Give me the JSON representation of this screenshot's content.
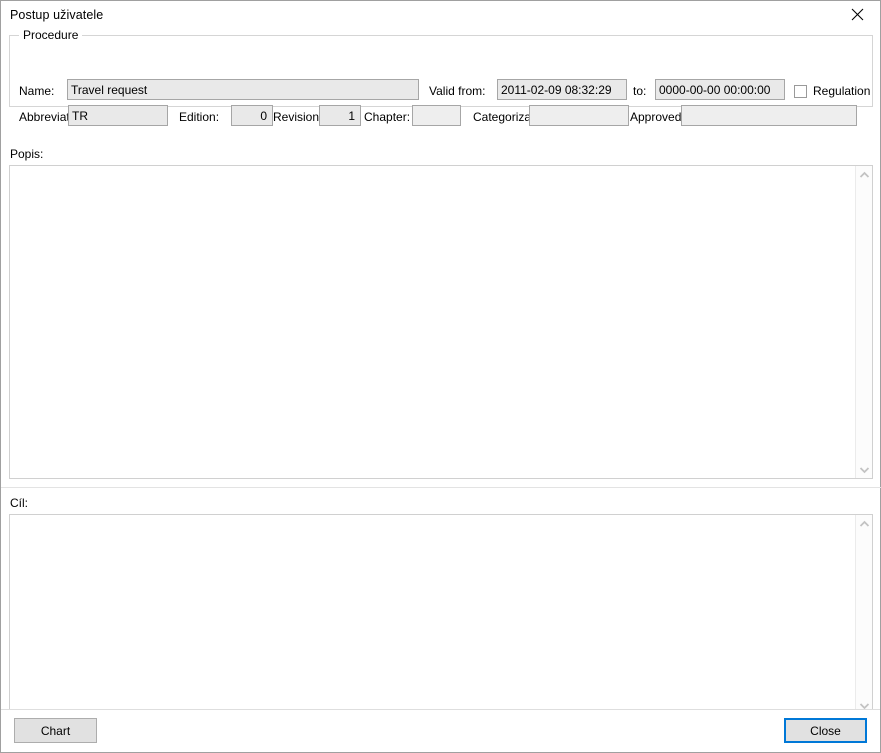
{
  "window": {
    "title": "Postup uživatele",
    "close_icon": "close-icon"
  },
  "procedure_group": {
    "legend": "Procedure",
    "fields": {
      "name_label": "Name:",
      "name_value": "Travel request",
      "valid_from_label": "Valid from:",
      "valid_from_value": "2011-02-09 08:32:29",
      "to_label": "to:",
      "to_value": "0000-00-00 00:00:00",
      "regulation_label": "Regulation",
      "regulation_checked": false,
      "abbreviation_label": "Abbreviation",
      "abbreviation_value": "TR",
      "edition_label": "Edition:",
      "edition_value": "0",
      "revision_label": "Revision",
      "revision_value": "1",
      "chapter_label": "Chapter:",
      "chapter_value": "",
      "categorization_label": "Categorization",
      "categorization_value": "",
      "approved_label": "Approved",
      "approved_value": ""
    }
  },
  "description_section": {
    "label": "Popis:",
    "value": "",
    "scroll_up_icon": "chevron-up-icon",
    "scroll_down_icon": "chevron-down-icon"
  },
  "goal_section": {
    "label": "Cíl:",
    "value": "",
    "scroll_up_icon": "chevron-up-icon",
    "scroll_down_icon": "chevron-down-icon"
  },
  "footer": {
    "chart_button": "Chart",
    "close_button": "Close"
  },
  "colors": {
    "focus_blue": "#0078d7",
    "field_bg": "#e9e9e9",
    "button_bg": "#e1e1e1"
  }
}
